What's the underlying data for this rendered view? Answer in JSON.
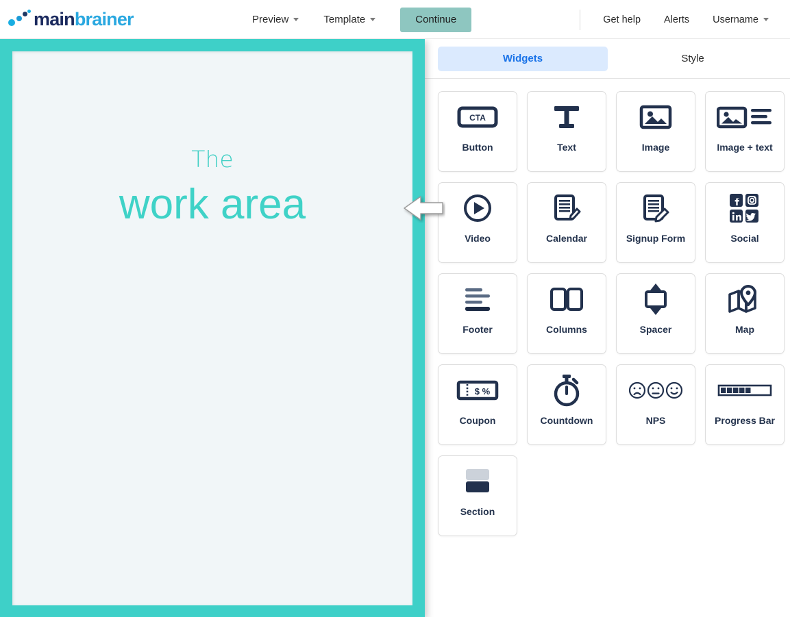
{
  "header": {
    "logo": {
      "part_a": "main",
      "part_b": "brainer",
      "icon": "mainbrainer-dots-logo"
    },
    "nav_center": [
      {
        "label": "Preview",
        "has_caret": true,
        "name": "preview"
      },
      {
        "label": "Template",
        "has_caret": true,
        "name": "template"
      }
    ],
    "continue_label": "Continue",
    "nav_right": [
      {
        "label": "Get help",
        "has_caret": false,
        "name": "get-help"
      },
      {
        "label": "Alerts",
        "has_caret": false,
        "name": "alerts"
      },
      {
        "label": "Username",
        "has_caret": true,
        "name": "username"
      }
    ]
  },
  "workarea": {
    "line1": "The",
    "line2": "work area",
    "border_color": "#3ed0c8",
    "inner_color": "#f1f6f8",
    "text_color": "#3fd2c7",
    "pointer_icon": "left-arrow-pointer"
  },
  "panel": {
    "tabs": [
      {
        "label": "Widgets",
        "active": true,
        "name": "widgets"
      },
      {
        "label": "Style",
        "active": false,
        "name": "style"
      }
    ],
    "active_tab_bg": "#dbeafe",
    "active_tab_color": "#1a73e8",
    "widgets": [
      {
        "label": "Button",
        "icon": "cta-button-icon",
        "icon_text": "CTA"
      },
      {
        "label": "Text",
        "icon": "text-t-icon"
      },
      {
        "label": "Image",
        "icon": "image-icon"
      },
      {
        "label": "Image + text",
        "icon": "image-plus-text-icon"
      },
      {
        "label": "Video",
        "icon": "video-play-icon"
      },
      {
        "label": "Calendar",
        "icon": "calendar-pencil-icon"
      },
      {
        "label": "Signup Form",
        "icon": "signup-form-pencil-icon"
      },
      {
        "label": "Social",
        "icon": "social-networks-icon"
      },
      {
        "label": "Footer",
        "icon": "footer-lines-icon"
      },
      {
        "label": "Columns",
        "icon": "columns-icon"
      },
      {
        "label": "Spacer",
        "icon": "spacer-arrows-icon"
      },
      {
        "label": "Map",
        "icon": "map-pin-icon"
      },
      {
        "label": "Coupon",
        "icon": "coupon-ticket-icon",
        "icon_text": "$ %"
      },
      {
        "label": "Countdown",
        "icon": "stopwatch-icon"
      },
      {
        "label": "NPS",
        "icon": "nps-faces-icon"
      },
      {
        "label": "Progress Bar",
        "icon": "progress-bar-icon"
      },
      {
        "label": "Section",
        "icon": "section-blocks-icon"
      }
    ]
  }
}
